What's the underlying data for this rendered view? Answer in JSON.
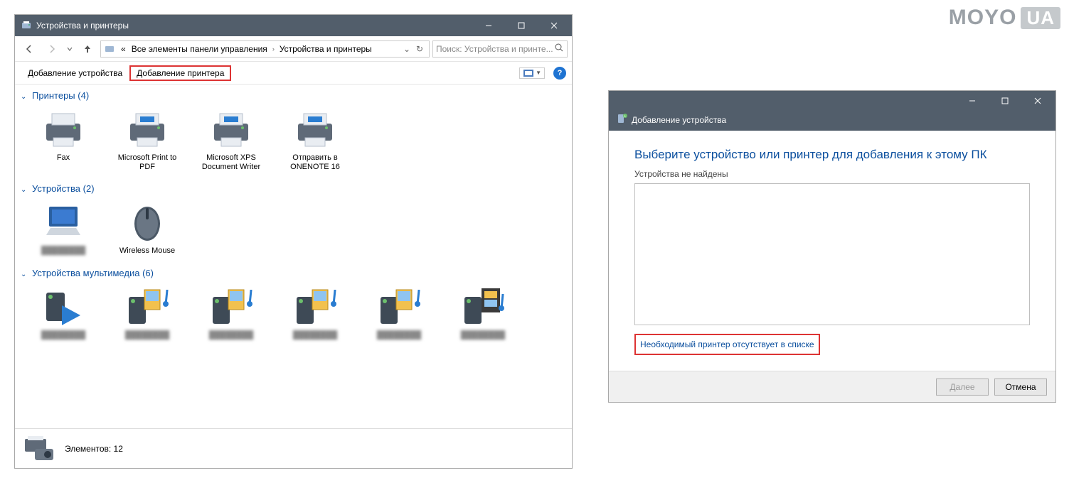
{
  "logo": {
    "brand": "MOYO",
    "suffix": "UA"
  },
  "win1": {
    "title": "Устройства и принтеры",
    "breadcrumbs": {
      "prefix": "«",
      "a": "Все элементы панели управления",
      "b": "Устройства и принтеры"
    },
    "search_placeholder": "Поиск: Устройства и принте...",
    "cmd_add_device": "Добавление устройства",
    "cmd_add_printer": "Добавление принтера",
    "groups": {
      "printers": {
        "title": "Принтеры (4)",
        "items": [
          {
            "label": "Fax"
          },
          {
            "label": "Microsoft Print to PDF"
          },
          {
            "label": "Microsoft XPS Document Writer"
          },
          {
            "label": "Отправить в ONENOTE 16"
          }
        ]
      },
      "devices": {
        "title": "Устройства (2)",
        "items": [
          {
            "label": "████████"
          },
          {
            "label": "Wireless Mouse"
          }
        ]
      },
      "multimedia": {
        "title": "Устройства мультимедиа (6)",
        "items": [
          {
            "label": "████████"
          },
          {
            "label": "████████"
          },
          {
            "label": "████████"
          },
          {
            "label": "████████"
          },
          {
            "label": "████████"
          },
          {
            "label": "████████"
          }
        ]
      }
    },
    "status": {
      "label": "Элементов:",
      "count": "12"
    }
  },
  "win2": {
    "title": "Добавление устройства",
    "heading": "Выберите устройство или принтер для добавления к этому ПК",
    "subtext": "Устройства не найдены",
    "link": "Необходимый принтер отсутствует в списке",
    "btn_next": "Далее",
    "btn_cancel": "Отмена"
  }
}
